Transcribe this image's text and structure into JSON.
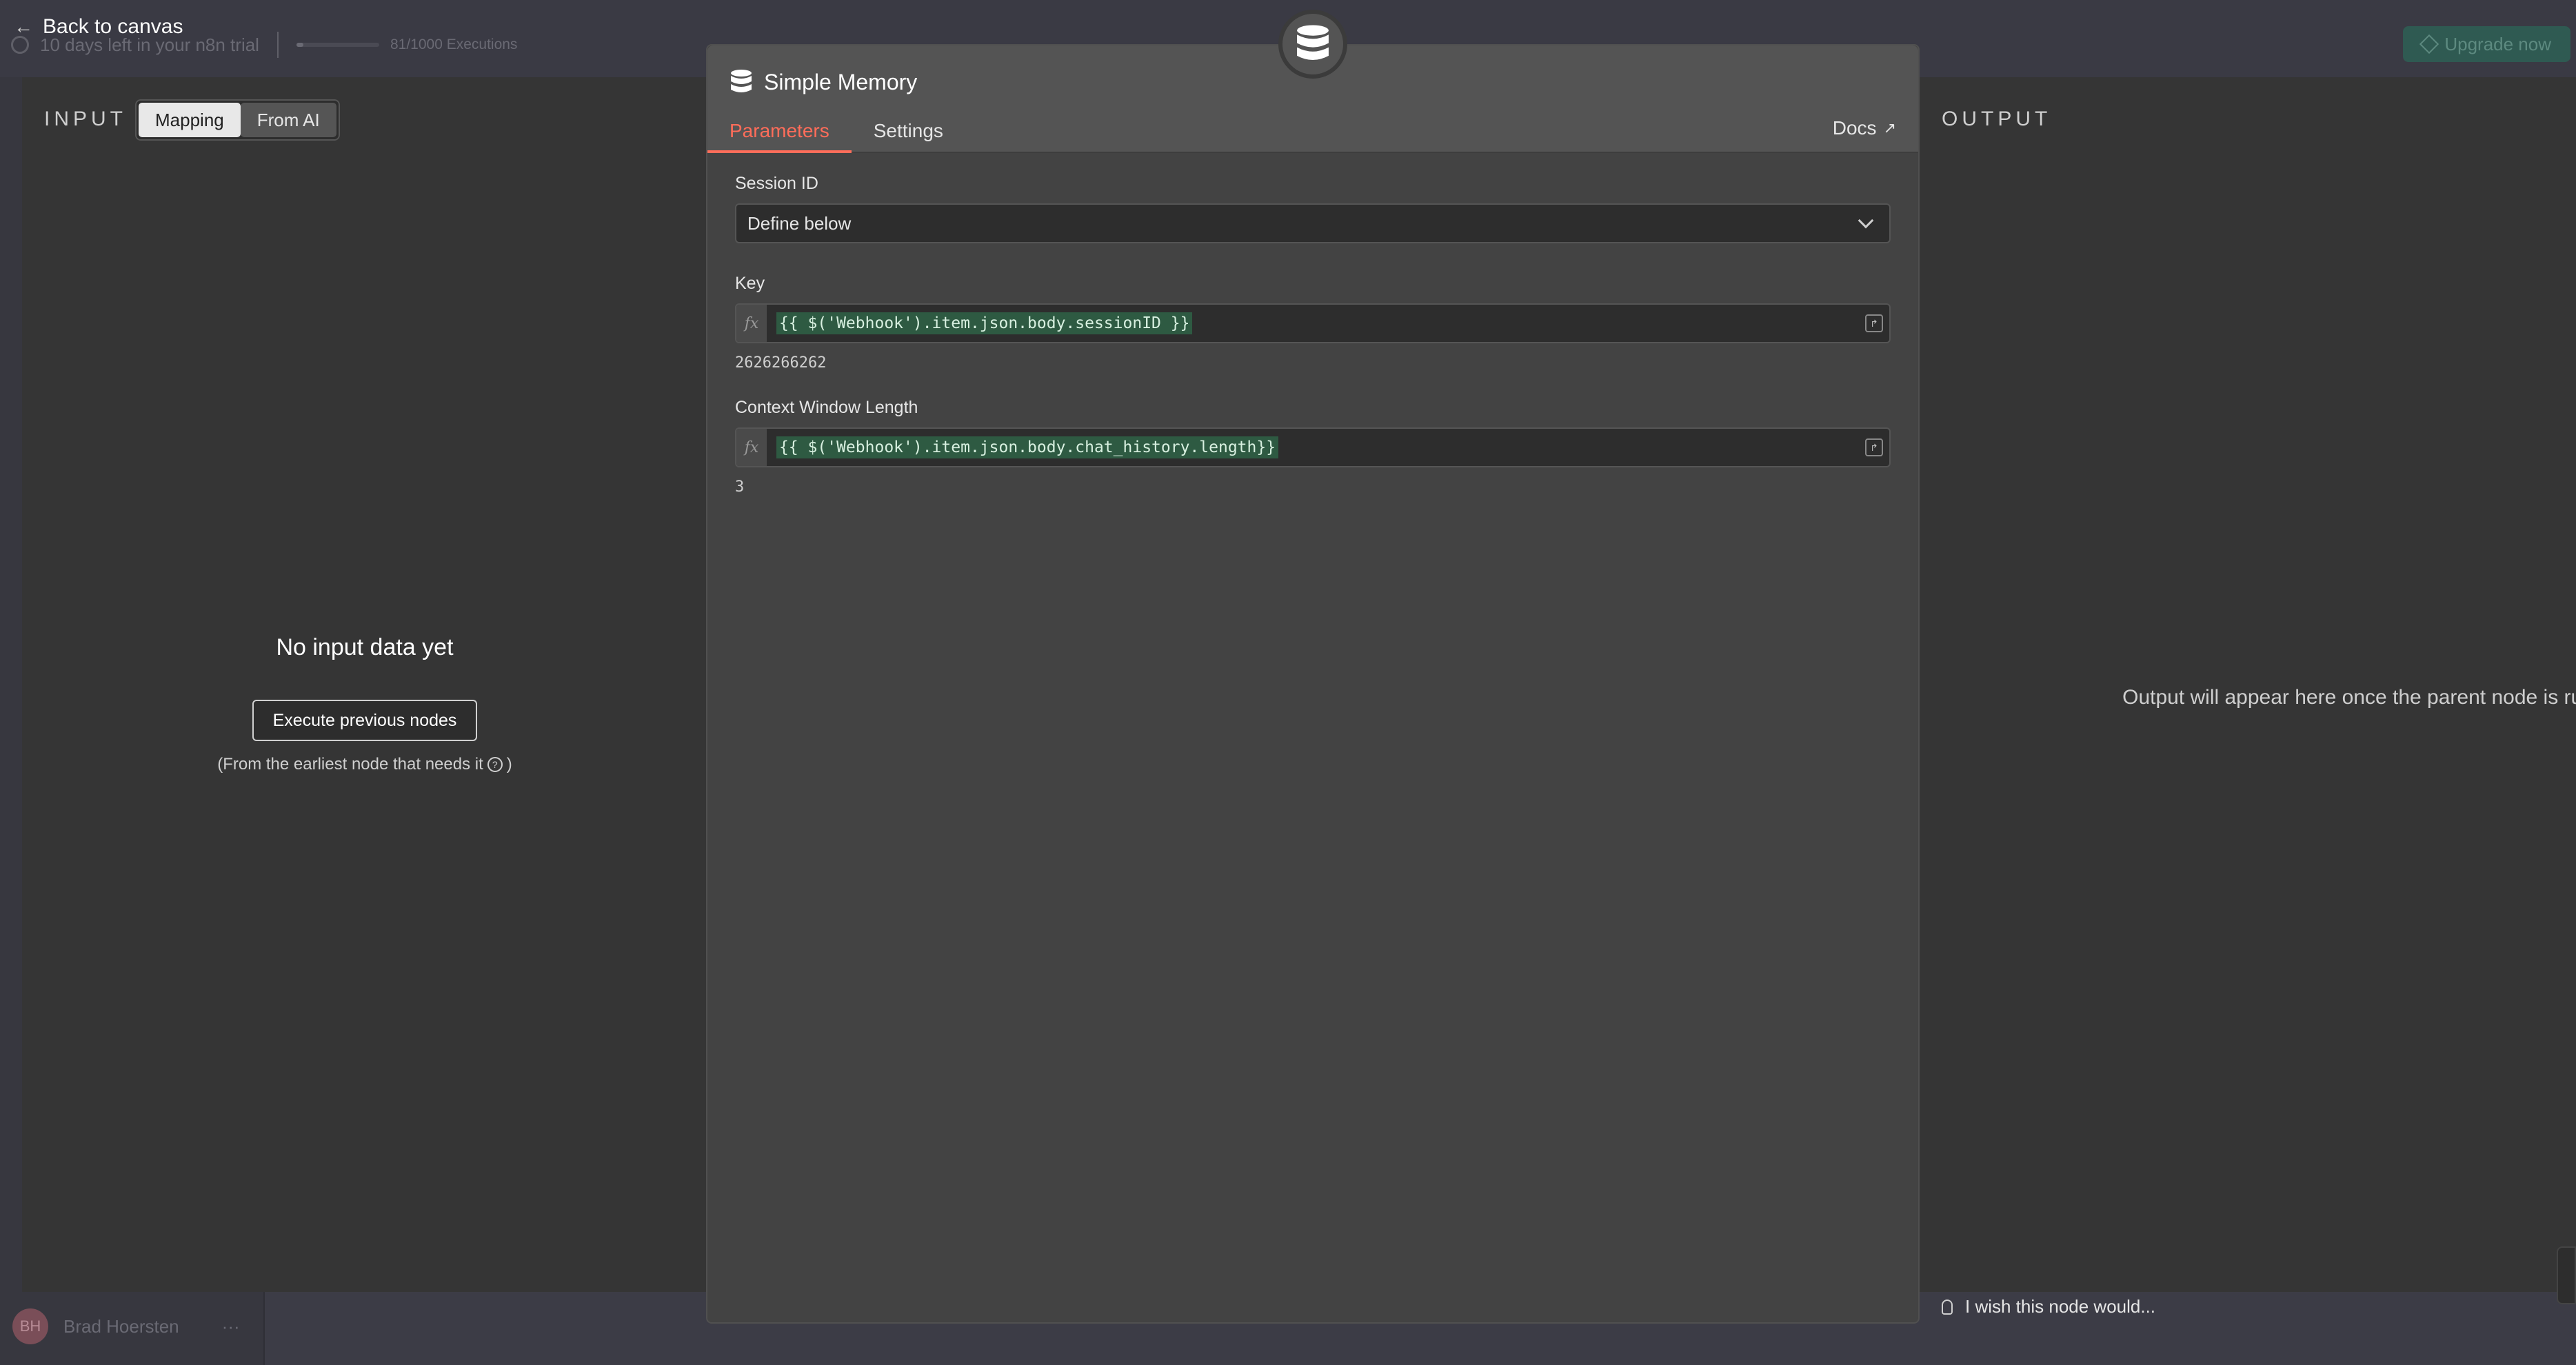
{
  "topbar": {
    "trial_text": "10 days left in your n8n trial",
    "executions_text": "81/1000 Executions",
    "executions_fraction": 0.081,
    "upgrade_label": "Upgrade now"
  },
  "back_label": "Back to canvas",
  "user": {
    "initials": "BH",
    "name": "Brad Hoersten",
    "menu": "···"
  },
  "input_panel": {
    "title": "INPUT",
    "toggle": [
      "Mapping",
      "From AI"
    ],
    "empty_title": "No input data yet",
    "execute_button": "Execute previous nodes",
    "hint": "(From the earliest node that needs it",
    "hint_close": ")"
  },
  "output_panel": {
    "title": "OUTPUT",
    "message": "Output will appear here once the parent node is run",
    "wish": "I wish this node would..."
  },
  "node": {
    "title": "Simple Memory",
    "icon": "database-icon",
    "tabs": [
      "Parameters",
      "Settings"
    ],
    "docs_label": "Docs",
    "params": {
      "session_id_label": "Session ID",
      "session_id_value": "Define below",
      "key_label": "Key",
      "key_expression": "{{ $('Webhook').item.json.body.sessionID }}",
      "key_result": "2626266262",
      "context_label": "Context Window Length",
      "context_expression": "{{ $('Webhook').item.json.body.chat_history.length}}",
      "context_result": "3"
    }
  },
  "colors": {
    "accent": "#ff6d5a",
    "expression_bg": "#2e5a42",
    "panel_bg": "#434343"
  }
}
